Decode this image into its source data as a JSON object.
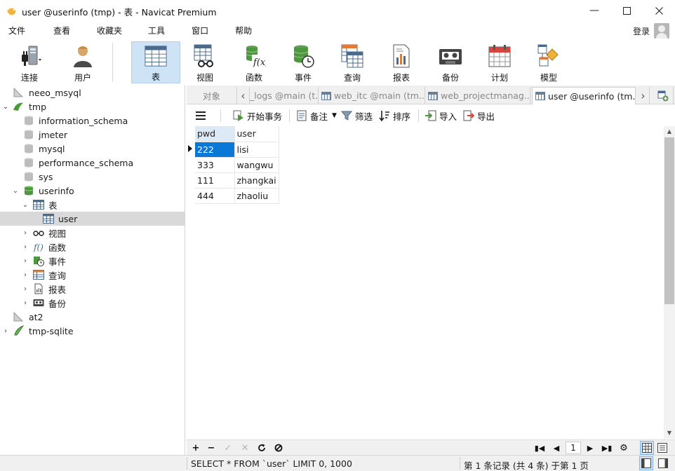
{
  "window": {
    "title": "user @userinfo (tmp) - 表 - Navicat Premium",
    "controls": [
      "minimize",
      "maximize",
      "close"
    ]
  },
  "menu": [
    "文件",
    "查看",
    "收藏夹",
    "工具",
    "窗口",
    "帮助"
  ],
  "login_label": "登录",
  "toolbar": {
    "connect": "连接",
    "user": "用户",
    "table": "表",
    "view": "视图",
    "function": "函数",
    "event": "事件",
    "query": "查询",
    "report": "报表",
    "backup": "备份",
    "schedule": "计划",
    "model": "模型"
  },
  "tree": {
    "neeo": "neeo_msyql",
    "tmp": "tmp",
    "info_schema": "information_schema",
    "jmeter": "jmeter",
    "mysql": "mysql",
    "perf_schema": "performance_schema",
    "sys": "sys",
    "userinfo": "userinfo",
    "tables": "表",
    "user_table": "user",
    "views": "视图",
    "functions": "函数",
    "events": "事件",
    "queries": "查询",
    "reports": "报表",
    "backups": "备份",
    "at2": "at2",
    "tmp_sqlite": "tmp-sqlite"
  },
  "tabs": {
    "objects": "对象",
    "tab1": "_logs @main (t...",
    "tab2": "web_itc @main (tm...",
    "tab3": "web_projectmanag...",
    "tab4": "user @userinfo (tm..."
  },
  "objbar": {
    "begin_tx": "开始事务",
    "memo": "备注",
    "filter": "筛选",
    "sort": "排序",
    "import": "导入",
    "export": "导出"
  },
  "grid": {
    "columns": [
      "pwd",
      "user"
    ],
    "rows": [
      [
        "222",
        "lisi"
      ],
      [
        "333",
        "wangwu"
      ],
      [
        "111",
        "zhangkai"
      ],
      [
        "444",
        "zhaoliu"
      ]
    ]
  },
  "nav": {
    "page": "1"
  },
  "status": {
    "sql": "SELECT * FROM `user` LIMIT 0, 1000",
    "count": "第 1 条记录 (共 4 条) 于第 1 页"
  }
}
